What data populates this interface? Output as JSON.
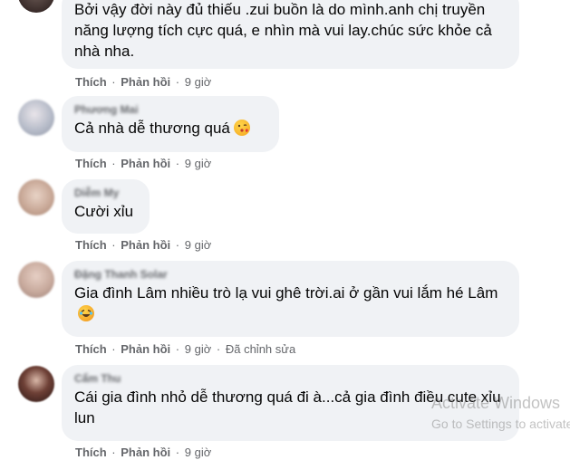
{
  "comments": [
    {
      "author": "",
      "text": "Bởi vậy đời này đủ thiếu .zui buồn là do mình.anh chị truyền năng lượng tích cực quá, e nhìn mà vui lay.chúc sức khỏe cả nhà nha.",
      "like": "Thích",
      "reply": "Phản hồi",
      "time": "9 giờ",
      "edited": ""
    },
    {
      "author": "Phương Mai",
      "text": "Cả nhà dễ thương quá",
      "emoji": "kissing-face-emoji",
      "like": "Thích",
      "reply": "Phản hồi",
      "time": "9 giờ",
      "edited": ""
    },
    {
      "author": "Diễm My",
      "text": "Cười xỉu",
      "like": "Thích",
      "reply": "Phản hồi",
      "time": "9 giờ",
      "edited": ""
    },
    {
      "author": "Đặng Thanh Solar",
      "text": "Gia đình Lâm nhiều trò lạ vui ghê trời.ai ở gần vui lắm hé Lâm",
      "emoji": "laughing-face-emoji",
      "like": "Thích",
      "reply": "Phản hồi",
      "time": "9 giờ",
      "edited": "Đã chỉnh sửa"
    },
    {
      "author": "Cẩm Thu",
      "text": "Cái gia đình nhỏ dễ thương quá đi à...cả gia đình điều cute xỉu lun",
      "like": "Thích",
      "reply": "Phản hồi",
      "time": "9 giờ",
      "edited": ""
    }
  ],
  "separator": "·",
  "watermark": {
    "title": "Activate Windows",
    "subtitle": "Go to Settings to activate Windows."
  },
  "colors": {
    "bubble": "#f0f2f5",
    "text": "#050505",
    "meta": "#65676b"
  }
}
